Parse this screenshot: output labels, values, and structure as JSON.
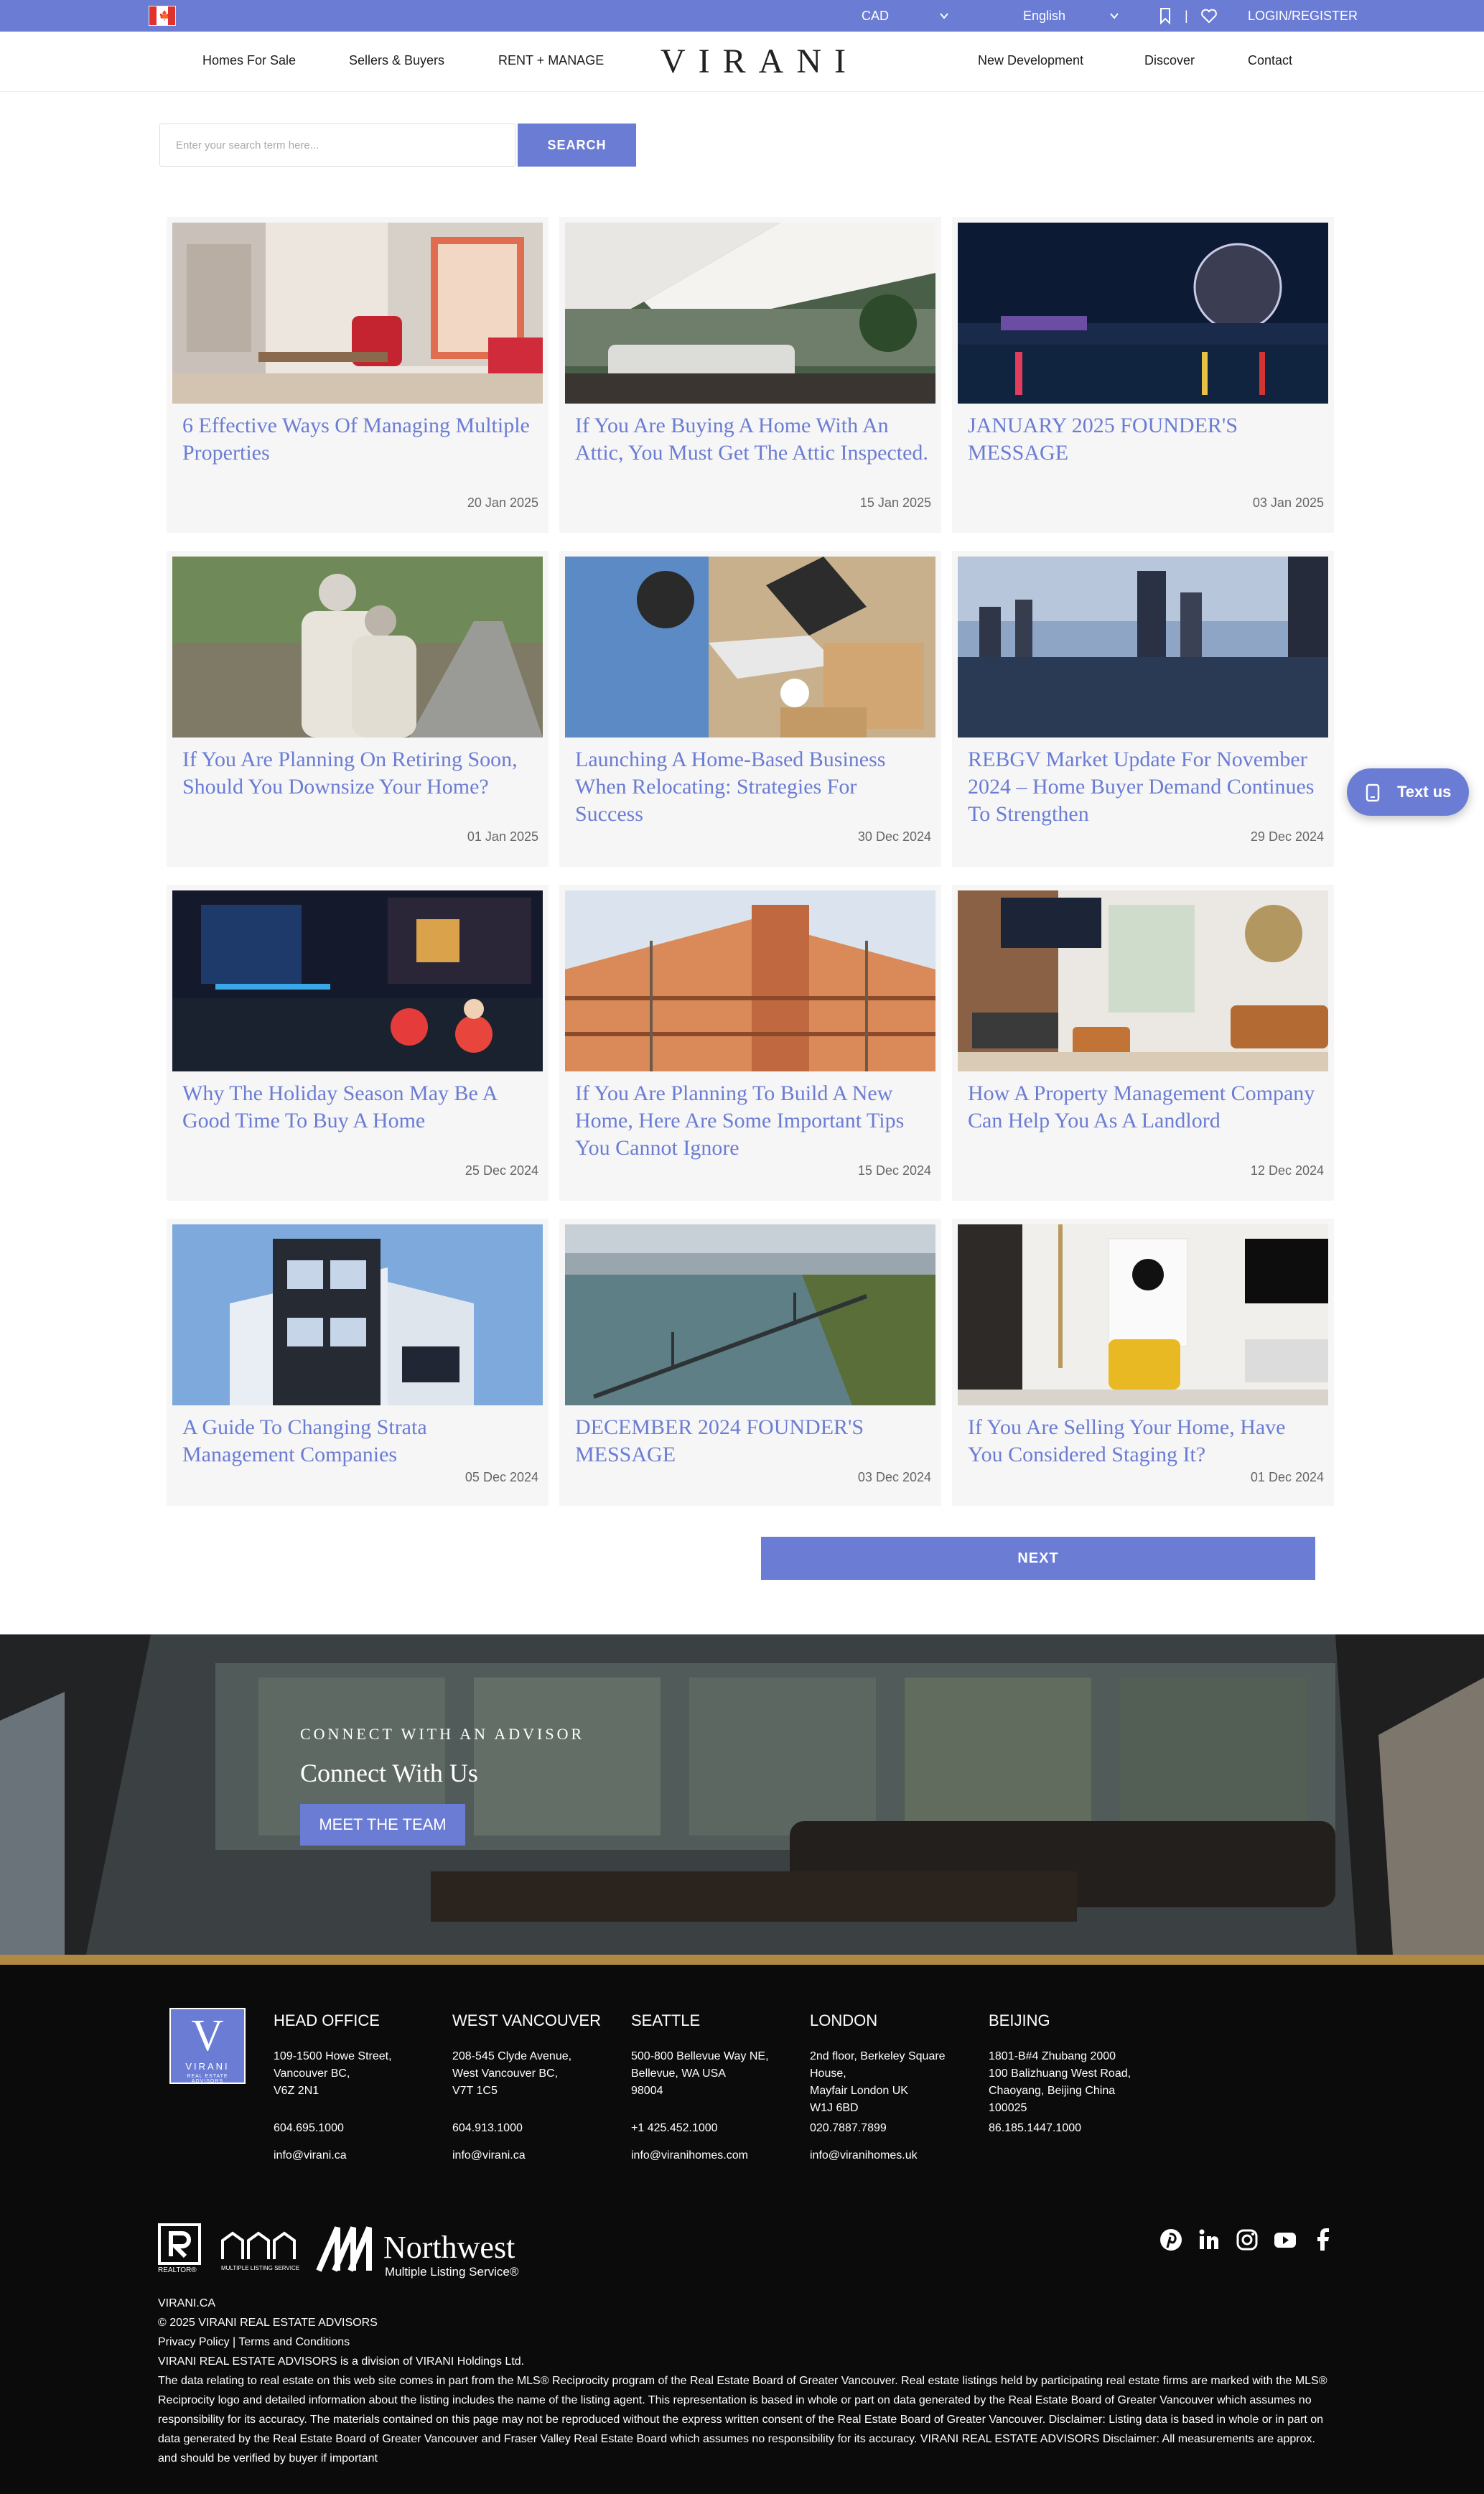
{
  "topbar": {
    "currency": "CAD",
    "language": "English",
    "login_label": "LOGIN/REGISTER",
    "separator": "|"
  },
  "nav": {
    "left": [
      "Homes For Sale",
      "Sellers & Buyers",
      "RENT + MANAGE"
    ],
    "logo": "VIRANI",
    "right": [
      "New Development",
      "Discover",
      "Contact"
    ]
  },
  "search": {
    "placeholder": "Enter your search term here...",
    "button_label": "SEARCH"
  },
  "posts": [
    {
      "title": "6 Effective Ways Of Managing Multiple Properties",
      "date": "20 Jan 2025",
      "image": "living-room-photo"
    },
    {
      "title": "If You Are Buying A Home With An Attic, You Must Get The Attic Inspected.",
      "date": "15 Jan 2025",
      "image": "attic-patio-photo"
    },
    {
      "title": "JANUARY 2025 FOUNDER'S MESSAGE",
      "date": "03 Jan 2025",
      "image": "science-world-night-photo"
    },
    {
      "title": "If You Are Planning On Retiring Soon, Should You Downsize Your Home?",
      "date": "01 Jan 2025",
      "image": "retired-couple-photo"
    },
    {
      "title": "Launching A Home-Based Business When Relocating: Strategies For Success",
      "date": "30 Dec 2024",
      "image": "laptop-boxes-photo"
    },
    {
      "title": "REBGV Market Update For November 2024 – Home Buyer Demand Continues To Strengthen",
      "date": "29 Dec 2024",
      "image": "vancouver-skyline-photo"
    },
    {
      "title": "Why The Holiday Season May Be A Good Time To Buy A Home",
      "date": "25 Dec 2024",
      "image": "holiday-lights-house-photo"
    },
    {
      "title": "If You Are Planning To Build A New Home, Here Are Some Important Tips You Cannot Ignore",
      "date": "15 Dec 2024",
      "image": "house-framing-photo"
    },
    {
      "title": "How A Property Management Company Can Help You As A Landlord",
      "date": "12 Dec 2024",
      "image": "modern-living-room-photo"
    },
    {
      "title": "A Guide To Changing Strata Management Companies",
      "date": "05 Dec 2024",
      "image": "modern-building-photo"
    },
    {
      "title": "DECEMBER 2024 FOUNDER'S MESSAGE",
      "date": "03 Dec 2024",
      "image": "lions-gate-bridge-photo"
    },
    {
      "title": "If You Are Selling Your Home, Have You Considered Staging It?",
      "date": "01 Dec 2024",
      "image": "staged-room-photo"
    }
  ],
  "pagination": {
    "next_label": "NEXT"
  },
  "connect": {
    "eyebrow": "CONNECT WITH AN ADVISOR",
    "heading": "Connect With Us",
    "button_label": "MEET THE TEAM"
  },
  "footer": {
    "logo": {
      "letter": "V",
      "name": "VIRANI",
      "tagline": "REAL ESTATE ADVISORS"
    },
    "offices": [
      {
        "name": "HEAD OFFICE",
        "address": [
          "109-1500 Howe Street,",
          "Vancouver BC,",
          "V6Z 2N1"
        ],
        "phone": "604.695.1000",
        "email": "info@virani.ca"
      },
      {
        "name": "WEST VANCOUVER",
        "address": [
          "208-545 Clyde Avenue,",
          "West Vancouver BC,",
          "V7T 1C5"
        ],
        "phone": "604.913.1000",
        "email": "info@virani.ca"
      },
      {
        "name": "SEATTLE",
        "address": [
          "500-800 Bellevue Way NE,",
          "Bellevue, WA USA",
          "98004"
        ],
        "phone": "+1 425.452.1000",
        "email": "info@viranihomes.com"
      },
      {
        "name": "LONDON",
        "address": [
          "2nd floor, Berkeley Square",
          "House,",
          "Mayfair London UK",
          "W1J 6BD"
        ],
        "phone": "020.7887.7899",
        "email": "info@viranihomes.uk"
      },
      {
        "name": "BEIJING",
        "address": [
          "1801-B#4 Zhubang 2000",
          "100 Balizhuang West Road,",
          "Chaoyang, Beijing China",
          "100025"
        ],
        "phone": "86.185.1447.1000",
        "email": ""
      }
    ],
    "badges": {
      "realtor": "REALTOR®",
      "mls": "MULTIPLE LISTING SERVICE",
      "northwest_name": "Northwest",
      "northwest_sub": "Multiple Listing Service®"
    },
    "social_icons": [
      "pinterest-icon",
      "linkedin-icon",
      "instagram-icon",
      "youtube-icon",
      "facebook-icon"
    ],
    "site": "VIRANI.CA",
    "copyright": "© 2025 VIRANI REAL ESTATE ADVISORS",
    "privacy_label": "Privacy Policy",
    "divider": " | ",
    "terms_label": "Terms and Conditions",
    "division": "VIRANI REAL ESTATE ADVISORS is a division of VIRANI Holdings Ltd.",
    "disclaimer": "The data relating to real estate on this web site comes in part from the MLS® Reciprocity program of the Real Estate Board of Greater Vancouver. Real estate listings held by participating real estate firms are marked with the MLS® Reciprocity logo and detailed information about the listing includes the name of the listing agent. This representation is based in whole or part on data generated by the Real Estate Board of Greater Vancouver which assumes no responsibility for its accuracy. The materials contained on this page may not be reproduced without the express written consent of the Real Estate Board of Greater Vancouver. Disclaimer: Listing data is based in whole or in part on data generated by the Real Estate Board of Greater Vancouver and Fraser Valley Real Estate Board which assumes no responsibility for its accuracy. VIRANI REAL ESTATE ADVISORS Disclaimer: All measurements are approx. and should be verified by buyer if important"
  },
  "chat": {
    "label": "Text us"
  },
  "colors": {
    "accent": "#6b7cd4",
    "gold": "#b08a43",
    "footer_bg": "#0b0b0b"
  }
}
